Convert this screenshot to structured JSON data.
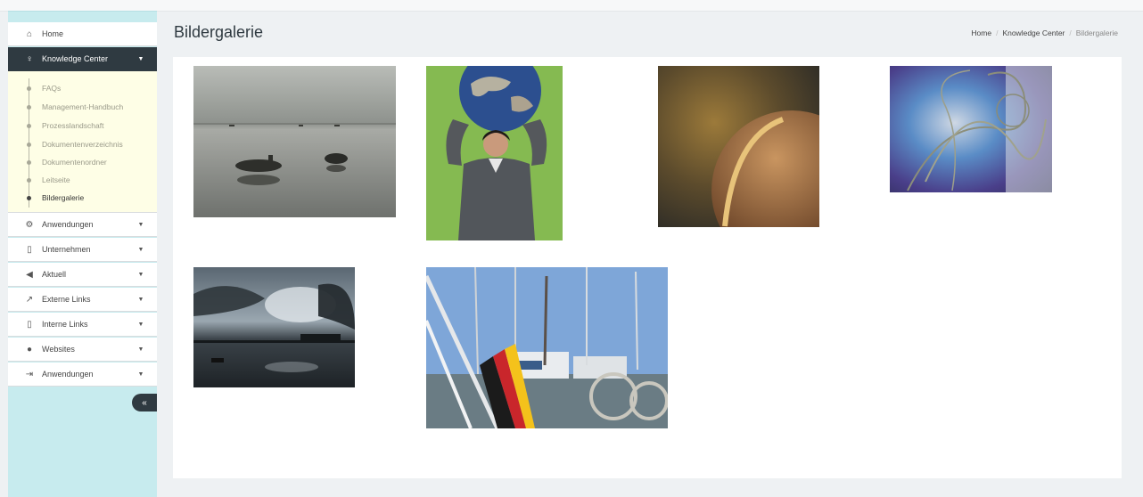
{
  "sidebar": {
    "items": [
      {
        "label": "Home",
        "icon": "home-icon"
      },
      {
        "label": "Knowledge Center",
        "icon": "lightbulb-icon"
      },
      {
        "label": "Anwendungen",
        "icon": "cogs-icon"
      },
      {
        "label": "Unternehmen",
        "icon": "building-icon"
      },
      {
        "label": "Aktuell",
        "icon": "bullhorn-icon"
      },
      {
        "label": "Externe Links",
        "icon": "external-link-icon"
      },
      {
        "label": "Interne Links",
        "icon": "bookmark-icon"
      },
      {
        "label": "Websites",
        "icon": "globe-icon"
      },
      {
        "label": "Anwendungen",
        "icon": "sign-out-icon"
      }
    ],
    "submenu": [
      {
        "label": "FAQs"
      },
      {
        "label": "Management-Handbuch"
      },
      {
        "label": "Prozesslandschaft"
      },
      {
        "label": "Dokumentenverzeichnis"
      },
      {
        "label": "Dokumentenordner"
      },
      {
        "label": "Leitseite"
      },
      {
        "label": "Bildergalerie"
      }
    ],
    "collapse_icon": "double-chevron-left-icon"
  },
  "header": {
    "title": "Bildergalerie",
    "breadcrumb": [
      "Home",
      "Knowledge Center",
      "Bildergalerie"
    ]
  },
  "gallery": {
    "images": [
      {
        "subject": "boats-lake"
      },
      {
        "subject": "woman-globe"
      },
      {
        "subject": "sphere-dark"
      },
      {
        "subject": "abstract-wires"
      },
      {
        "subject": "sunset-lake"
      },
      {
        "subject": "harbor-boats"
      }
    ]
  }
}
